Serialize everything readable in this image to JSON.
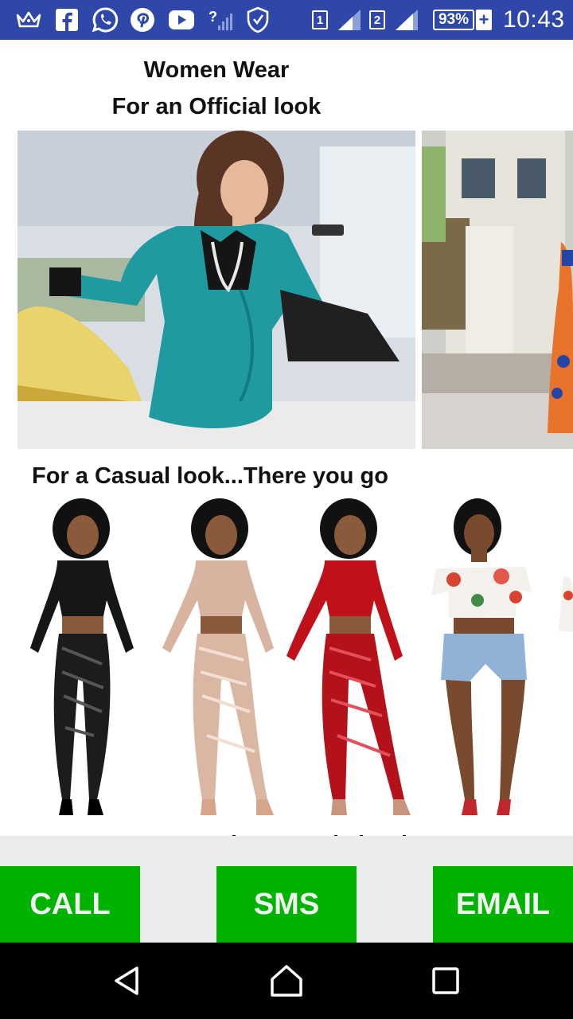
{
  "status_bar": {
    "icons": [
      "crown-icon",
      "facebook-icon",
      "whatsapp-icon",
      "pinterest-icon",
      "youtube-icon",
      "no-data-signal-icon",
      "shield-icon"
    ],
    "sim1_label": "1",
    "sim2_label": "2",
    "battery_percent": "93%",
    "charging_symbol": "+",
    "time": "10:43"
  },
  "content": {
    "heading_line1": "Women Wear",
    "heading_line2": "For an Official look",
    "casual_title": "For a Casual look...There you go"
  },
  "actions": {
    "call_label": "CALL",
    "sms_label": "SMS",
    "email_label": "EMAIL"
  },
  "navigation": {
    "buttons": [
      "back-icon",
      "home-icon",
      "recents-icon"
    ]
  },
  "colors": {
    "status_bar": "#2e47a8",
    "action_button": "#00b300",
    "band": "#ececec",
    "nav_bar": "#000000"
  }
}
